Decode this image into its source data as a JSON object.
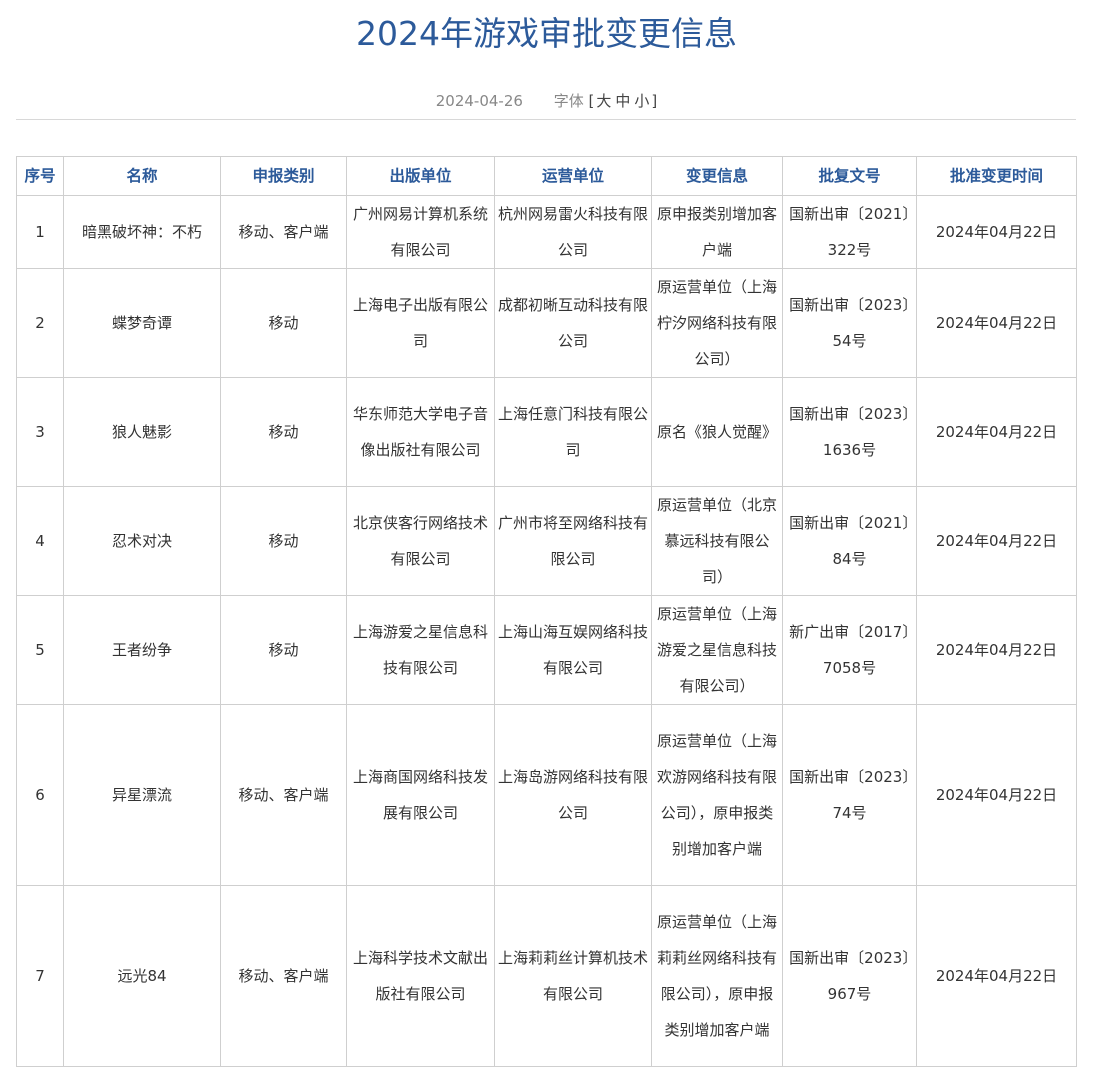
{
  "page": {
    "title": "2024年游戏审批变更信息",
    "date": "2024-04-26",
    "font_label": "字体",
    "font_open": "[",
    "font_close": "]",
    "font_sizes": [
      "大",
      "中",
      "小"
    ]
  },
  "table": {
    "headers": [
      "序号",
      "名称",
      "申报类别",
      "出版单位",
      "运营单位",
      "变更信息",
      "批复文号",
      "批准变更时间"
    ],
    "rows": [
      {
        "no": "1",
        "name": "暗黑破坏神：不朽",
        "category": "移动、客户端",
        "publisher": "广州网易计算机系统有限公司",
        "operator": "杭州网易雷火科技有限公司",
        "change": "原申报类别增加客户端",
        "approval": "国新出审〔2021〕322号",
        "date": "2024年04月22日"
      },
      {
        "no": "2",
        "name": "蝶梦奇谭",
        "category": "移动",
        "publisher": "上海电子出版有限公司",
        "operator": "成都初晰互动科技有限公司",
        "change": "原运营单位（上海柠汐网络科技有限公司）",
        "approval": "国新出审〔2023〕54号",
        "date": "2024年04月22日"
      },
      {
        "no": "3",
        "name": "狼人魅影",
        "category": "移动",
        "publisher": "华东师范大学电子音像出版社有限公司",
        "operator": "上海任意门科技有限公司",
        "change": "原名《狼人觉醒》",
        "approval": "国新出审〔2023〕1636号",
        "date": "2024年04月22日"
      },
      {
        "no": "4",
        "name": "忍术对决",
        "category": "移动",
        "publisher": "北京侠客行网络技术有限公司",
        "operator": "广州市将至网络科技有限公司",
        "change": "原运营单位（北京慕远科技有限公司）",
        "approval": "国新出审〔2021〕84号",
        "date": "2024年04月22日"
      },
      {
        "no": "5",
        "name": "王者纷争",
        "category": "移动",
        "publisher": "上海游爱之星信息科技有限公司",
        "operator": "上海山海互娱网络科技有限公司",
        "change": "原运营单位（上海游爱之星信息科技有限公司）",
        "approval": "新广出审〔2017〕7058号",
        "date": "2024年04月22日"
      },
      {
        "no": "6",
        "name": "异星漂流",
        "category": "移动、客户端",
        "publisher": "上海商国网络科技发展有限公司",
        "operator": "上海岛游网络科技有限公司",
        "change": "原运营单位（上海欢游网络科技有限公司），原申报类别增加客户端",
        "approval": "国新出审〔2023〕74号",
        "date": "2024年04月22日"
      },
      {
        "no": "7",
        "name": "远光84",
        "category": "移动、客户端",
        "publisher": "上海科学技术文献出版社有限公司",
        "operator": "上海莉莉丝计算机技术有限公司",
        "change": "原运营单位（上海莉莉丝网络科技有限公司），原申报类别增加客户端",
        "approval": "国新出审〔2023〕967号",
        "date": "2024年04月22日"
      }
    ]
  },
  "colors": {
    "title": "#2c5a9a",
    "header_text": "#2c5a9a",
    "border": "#cfcfcf",
    "meta_text": "#888888"
  }
}
